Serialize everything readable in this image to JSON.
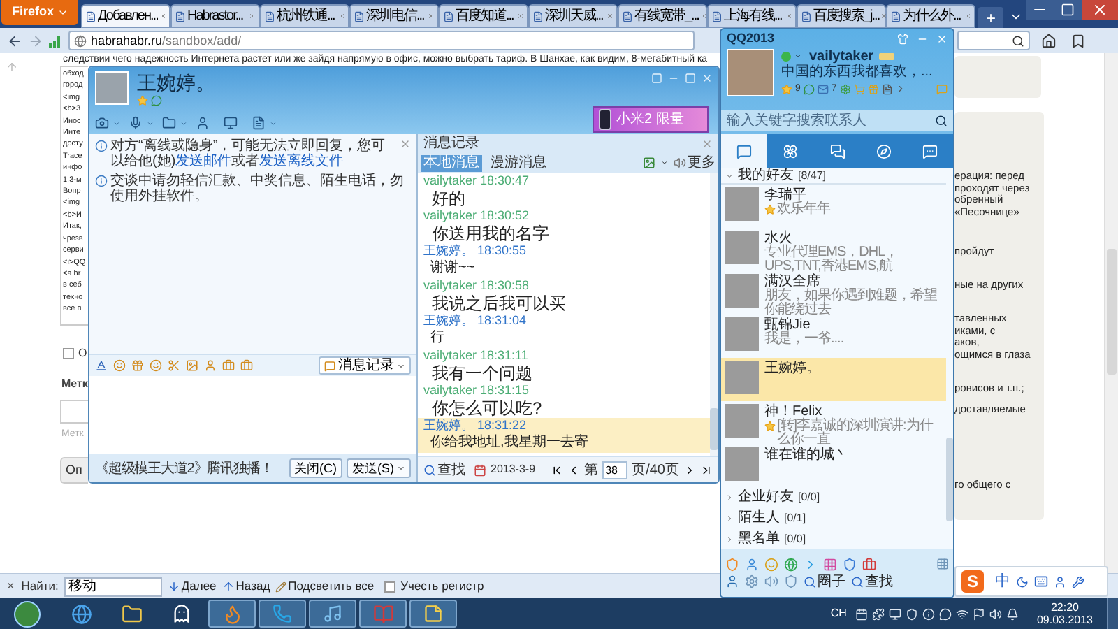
{
  "browser": {
    "menu_button": "Firefox",
    "tabs": [
      {
        "label": "Добавлен...",
        "selected": true
      },
      {
        "label": "Habrastor...",
        "selected": false
      },
      {
        "label": "杭州铁通...",
        "selected": false
      },
      {
        "label": "深圳电信...",
        "selected": false
      },
      {
        "label": "百度知道...",
        "selected": false
      },
      {
        "label": "深圳天威...",
        "selected": false
      },
      {
        "label": "有线宽带_...",
        "selected": false
      },
      {
        "label": "上海有线...",
        "selected": false
      },
      {
        "label": "百度搜索_j...",
        "selected": false
      },
      {
        "label": "为什么外...",
        "selected": false
      }
    ],
    "new_tab": "+",
    "url_host": "habrahabr.ru",
    "url_path": "/sandbox/add/",
    "page": {
      "intro": "следствии чего надежность Интернета растет или же зайдя напрямую в офис, можно выбрать тариф.  В Шанхае, как видим, 8-мегабитный ка",
      "left_lines": [
        "обход",
        "город",
        "<img",
        "<b>3",
        "Инос",
        "Инте",
        "досту",
        "Trace",
        "инфо",
        "1.3-м",
        "Вопр",
        "<img",
        "<b>И",
        "Итак,",
        "чрезв",
        "серви",
        "<i>QQ",
        "<a hr",
        "в себ",
        "техно",
        "все п"
      ],
      "checkbox": {
        "label": "О",
        "checked": false
      },
      "tags_label": "Метк",
      "tags_hint": "Метк",
      "submit": "Оп",
      "right_paragraphs": [
        [
          "ерация: перед",
          "проходят через",
          "обренный",
          "«Песочнице»"
        ],
        [
          "пройдут"
        ],
        [
          "ные на других"
        ],
        [
          "тавленных",
          "иками, с",
          "аков,",
          "ощимся в глаза"
        ],
        [
          "ровисов и т.п.;"
        ],
        [
          "доставляемые"
        ],
        [
          "го общего с"
        ]
      ]
    },
    "find_bar": {
      "close": "×",
      "label": "Найти:",
      "value": "移动",
      "next": "Далее",
      "prev": "Назад",
      "highlight": "Подсветить все",
      "match_case": {
        "label": "Учесть регистр",
        "checked": false
      }
    }
  },
  "chat_window": {
    "contact": "王婉婷。",
    "ad": "小米2 限量",
    "notices": [
      {
        "parts": [
          {
            "text": "对方“离线或隐身”，可能无法立即回复，您可以给他(她)",
            "link": false
          },
          {
            "text": "发送邮件",
            "link": true
          },
          {
            "text": "或者",
            "link": false
          },
          {
            "text": "发送离线文件",
            "link": true
          }
        ],
        "closable": true
      },
      {
        "parts": [
          {
            "text": "交谈中请勿轻信汇款、中奖信息、陌生电话，勿使用外挂软件。",
            "link": false
          }
        ],
        "closable": false
      }
    ],
    "history_button": "消息记录",
    "footer_ad": "《超级模王大道2》腾讯独播！",
    "close_button": "关闭(C)",
    "send_button": "发送(S)",
    "history": {
      "title": "消息记录",
      "tabs": [
        {
          "label": "本地消息",
          "selected": true
        },
        {
          "label": "漫游消息",
          "selected": false
        }
      ],
      "more": "更多",
      "messages": [
        {
          "kind": "self",
          "sender": "vailytaker",
          "time": "18:30:47",
          "text": "好的",
          "highlighted": false
        },
        {
          "kind": "self",
          "sender": "vailytaker",
          "time": "18:30:52",
          "text": "你送用我的名字",
          "highlighted": false
        },
        {
          "kind": "contact",
          "sender": "王婉婷。",
          "time": "18:30:55",
          "text": "谢谢~~",
          "highlighted": false
        },
        {
          "kind": "self",
          "sender": "vailytaker",
          "time": "18:30:58",
          "text": "我说之后我可以买",
          "highlighted": false
        },
        {
          "kind": "contact",
          "sender": "王婉婷。",
          "time": "18:31:04",
          "text": "行",
          "highlighted": false
        },
        {
          "kind": "self",
          "sender": "vailytaker",
          "time": "18:31:11",
          "text": "我有一个问题",
          "highlighted": false
        },
        {
          "kind": "self",
          "sender": "vailytaker",
          "time": "18:31:15",
          "text": "你怎么可以吃?",
          "highlighted": false
        },
        {
          "kind": "contact",
          "sender": "王婉婷。",
          "time": "18:31:22",
          "text": "你给我地址,我星期一去寄",
          "highlighted": true
        }
      ],
      "search": "查找",
      "date": "2013-3-9",
      "page_label": "第",
      "page": "38",
      "page_total": "页/40页"
    }
  },
  "qq": {
    "title": "QQ2013",
    "nickname": "vailytaker",
    "online": true,
    "signature": "中国的东西我都喜欢，...",
    "level_count": "9",
    "mail_count": "7",
    "search_placeholder": "输入关键字搜索联系人",
    "tabs": [
      {
        "selected": true
      },
      {
        "selected": false
      },
      {
        "selected": false
      },
      {
        "selected": false
      },
      {
        "selected": false
      }
    ],
    "groups": [
      {
        "name": "我的好友",
        "count": "[8/47]",
        "expanded": true,
        "contacts": [
          {
            "name": "李瑞平",
            "status": "欢乐年年",
            "starred": true,
            "selected": false
          },
          {
            "name": "水火",
            "status": "专业代理EMS，DHL，UPS,TNT,香港EMS,航",
            "starred": false,
            "selected": false
          },
          {
            "name": "满汉全席",
            "status": "朋友，如果你遇到难题，希望你能绕过去",
            "starred": false,
            "selected": false
          },
          {
            "name": "甄锦Jie",
            "status": "我是，一爷....",
            "starred": false,
            "selected": false
          },
          {
            "name": "王婉婷。",
            "starred": false,
            "selected": true
          },
          {
            "name": "神！Felix",
            "status": "[转]李嘉诚的深圳演讲:为什么你一直",
            "starred": true,
            "selected": false
          },
          {
            "name": "谁在谁的城丶",
            "starred": false,
            "selected": false
          }
        ]
      },
      {
        "name": "企业好友",
        "count": "[0/0]",
        "expanded": false
      },
      {
        "name": "陌生人",
        "count": "[0/1]",
        "expanded": false
      },
      {
        "name": "黑名单",
        "count": "[0/0]",
        "expanded": false
      }
    ],
    "circle": "圈子",
    "find": "查找"
  },
  "ime": {
    "logo": "S",
    "mode": "中"
  },
  "taskbar": {
    "apps": [
      {
        "running": false
      },
      {
        "running": false
      },
      {
        "running": false
      },
      {
        "running": true
      },
      {
        "running": true
      },
      {
        "running": true
      },
      {
        "running": true
      },
      {
        "running": true
      }
    ],
    "lang": "CH",
    "time": "22:20",
    "date": "09.03.2013"
  }
}
